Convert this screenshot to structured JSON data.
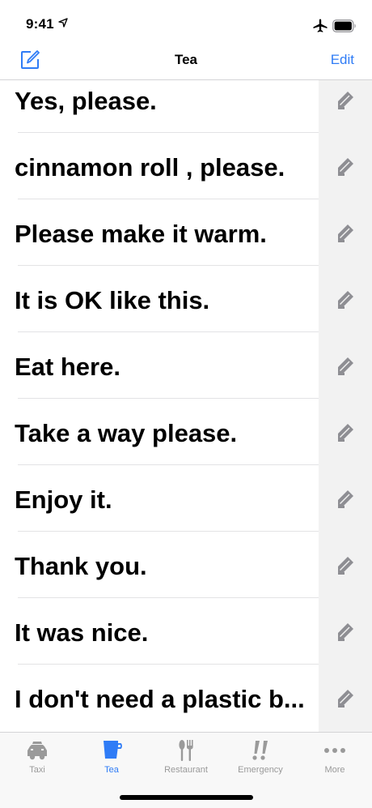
{
  "status_bar": {
    "time": "9:41",
    "location_icon": "location-arrow-icon",
    "airplane_icon": "airplane-icon",
    "battery_icon": "battery-icon"
  },
  "nav": {
    "compose_icon": "compose-icon",
    "title": "Tea",
    "edit_label": "Edit"
  },
  "phrases": [
    "Yes, please.",
    "cinnamon roll , please.",
    "Please make it warm.",
    "It is OK like this.",
    "Eat here.",
    "Take a way please.",
    "Enjoy it.",
    "Thank you.",
    "It was nice.",
    "I don't need a plastic b..."
  ],
  "row_edit_icon": "pencil-icon",
  "tabs": [
    {
      "label": "Taxi",
      "icon": "car-icon",
      "active": false
    },
    {
      "label": "Tea",
      "icon": "cup-icon",
      "active": true
    },
    {
      "label": "Restaurant",
      "icon": "fork-knife-icon",
      "active": false
    },
    {
      "label": "Emergency",
      "icon": "exclamation-icon",
      "active": false
    },
    {
      "label": "More",
      "icon": "more-dots-icon",
      "active": false
    }
  ],
  "colors": {
    "accent": "#2f7cf6",
    "inactive_tab": "#9a9a9a",
    "edit_icon": "#8e8e93"
  }
}
